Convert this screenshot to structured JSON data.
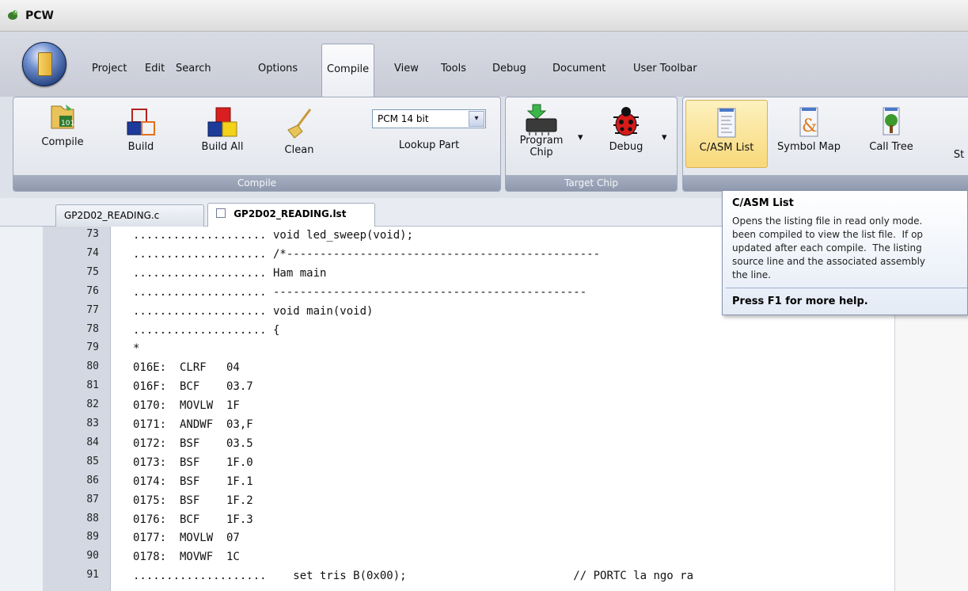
{
  "app": {
    "title": "PCW"
  },
  "menu": {
    "items": [
      "Project",
      "Edit",
      "Search",
      "Options",
      "Compile",
      "View",
      "Tools",
      "Debug",
      "Document",
      "User Toolbar"
    ],
    "active": "Compile"
  },
  "ribbon": {
    "compile_group": {
      "label": "Compile",
      "compile": "Compile",
      "build": "Build",
      "build_all": "Build All",
      "clean": "Clean",
      "chip_select": "PCM 14 bit",
      "lookup_part": "Lookup Part"
    },
    "target_group": {
      "label": "Target Chip",
      "program_chip_line1": "Program",
      "program_chip_line2": "Chip",
      "debug": "Debug"
    },
    "view_group": {
      "casm_list": "C/ASM List",
      "symbol_map": "Symbol Map",
      "call_tree": "Call Tree",
      "stats_partial": "St"
    }
  },
  "tabs": [
    "GP2D02_READING.c",
    "GP2D02_READING.lst"
  ],
  "active_tab": "GP2D02_READING.lst",
  "editor": {
    "lines": [
      {
        "n": "73",
        "text": ".................... void led_sweep(void);"
      },
      {
        "n": "74",
        "text": ".................... /*-----------------------------------------------"
      },
      {
        "n": "75",
        "text": ".................... Ham main"
      },
      {
        "n": "76",
        "text": ".................... -----------------------------------------------"
      },
      {
        "n": "77",
        "text": ".................... void main(void)"
      },
      {
        "n": "78",
        "text": ".................... {"
      },
      {
        "n": "79",
        "text": "*"
      },
      {
        "n": "80",
        "text": "016E:  CLRF   04"
      },
      {
        "n": "81",
        "text": "016F:  BCF    03.7"
      },
      {
        "n": "82",
        "text": "0170:  MOVLW  1F"
      },
      {
        "n": "83",
        "text": "0171:  ANDWF  03,F"
      },
      {
        "n": "84",
        "text": "0172:  BSF    03.5"
      },
      {
        "n": "85",
        "text": "0173:  BSF    1F.0"
      },
      {
        "n": "86",
        "text": "0174:  BSF    1F.1"
      },
      {
        "n": "87",
        "text": "0175:  BSF    1F.2"
      },
      {
        "n": "88",
        "text": "0176:  BCF    1F.3"
      },
      {
        "n": "89",
        "text": "0177:  MOVLW  07"
      },
      {
        "n": "90",
        "text": "0178:  MOVWF  1C"
      },
      {
        "n": "91",
        "text": "....................    set tris B(0x00);                         // PORTC la ngo ra"
      }
    ]
  },
  "tooltip": {
    "title": "C/ASM List",
    "body": "Opens the listing file in read only mode.\nbeen compiled to view the list file.  If op\nupdated after each compile.  The listing\nsource line and the associated assembly\nthe line.",
    "footer": "Press F1 for more help."
  }
}
